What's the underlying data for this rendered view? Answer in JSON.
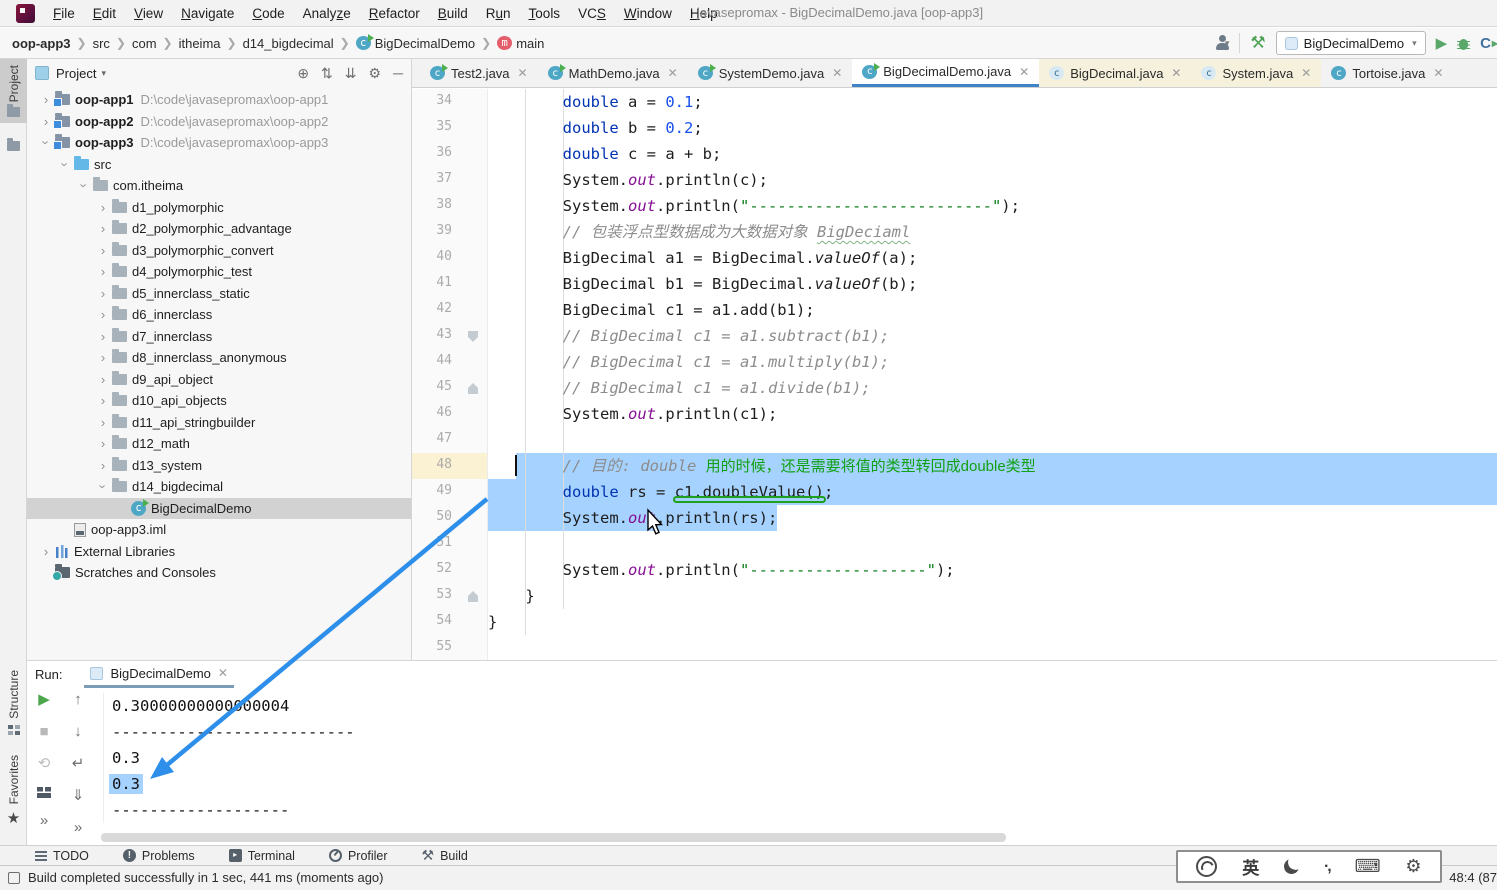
{
  "window": {
    "title": "javasepromax - BigDecimalDemo.java [oop-app3]",
    "menu": [
      {
        "label": "File",
        "u": 0
      },
      {
        "label": "Edit",
        "u": 0
      },
      {
        "label": "View",
        "u": 0
      },
      {
        "label": "Navigate",
        "u": 0
      },
      {
        "label": "Code",
        "u": 0
      },
      {
        "label": "Analyze",
        "u": 5
      },
      {
        "label": "Refactor",
        "u": 0
      },
      {
        "label": "Build",
        "u": 0
      },
      {
        "label": "Run",
        "u": 1
      },
      {
        "label": "Tools",
        "u": 0
      },
      {
        "label": "VCS",
        "u": 2
      },
      {
        "label": "Window",
        "u": 0
      },
      {
        "label": "Help",
        "u": 0
      }
    ]
  },
  "breadcrumb": [
    {
      "label": "oop-app3",
      "icon": null,
      "bold": true
    },
    {
      "label": "src",
      "icon": null
    },
    {
      "label": "com",
      "icon": null
    },
    {
      "label": "itheima",
      "icon": null
    },
    {
      "label": "d14_bigdecimal",
      "icon": null
    },
    {
      "label": "BigDecimalDemo",
      "icon": "class"
    },
    {
      "label": "main",
      "icon": "method"
    }
  ],
  "nav_toolbar": {
    "run_config": "BigDecimalDemo"
  },
  "left_strip": {
    "top_tab": "Project",
    "bottom_tabs": [
      "Structure",
      "Favorites"
    ]
  },
  "project_panel": {
    "title": "Project",
    "actions": [
      "locate",
      "expand-all",
      "collapse-all",
      "settings",
      "hide"
    ],
    "tree": [
      {
        "label": "oop-app1",
        "path": "D:\\code\\javasepromax\\oop-app1",
        "lvl": 0,
        "chev": "closed",
        "icon": "module",
        "bold": true
      },
      {
        "label": "oop-app2",
        "path": "D:\\code\\javasepromax\\oop-app2",
        "lvl": 0,
        "chev": "closed",
        "icon": "module",
        "bold": true
      },
      {
        "label": "oop-app3",
        "path": "D:\\code\\javasepromax\\oop-app3",
        "lvl": 0,
        "chev": "open",
        "icon": "module",
        "bold": true
      },
      {
        "label": "src",
        "lvl": 1,
        "chev": "open",
        "icon": "src"
      },
      {
        "label": "com.itheima",
        "lvl": 2,
        "chev": "open",
        "icon": "package"
      },
      {
        "label": "d1_polymorphic",
        "lvl": 3,
        "chev": "closed",
        "icon": "package"
      },
      {
        "label": "d2_polymorphic_advantage",
        "lvl": 3,
        "chev": "closed",
        "icon": "package"
      },
      {
        "label": "d3_polymorphic_convert",
        "lvl": 3,
        "chev": "closed",
        "icon": "package"
      },
      {
        "label": "d4_polymorphic_test",
        "lvl": 3,
        "chev": "closed",
        "icon": "package"
      },
      {
        "label": "d5_innerclass_static",
        "lvl": 3,
        "chev": "closed",
        "icon": "package"
      },
      {
        "label": "d6_innerclass",
        "lvl": 3,
        "chev": "closed",
        "icon": "package"
      },
      {
        "label": "d7_innerclass",
        "lvl": 3,
        "chev": "closed",
        "icon": "package"
      },
      {
        "label": "d8_innerclass_anonymous",
        "lvl": 3,
        "chev": "closed",
        "icon": "package"
      },
      {
        "label": "d9_api_object",
        "lvl": 3,
        "chev": "closed",
        "icon": "package"
      },
      {
        "label": "d10_api_objects",
        "lvl": 3,
        "chev": "closed",
        "icon": "package"
      },
      {
        "label": "d11_api_stringbuilder",
        "lvl": 3,
        "chev": "closed",
        "icon": "package"
      },
      {
        "label": "d12_math",
        "lvl": 3,
        "chev": "closed",
        "icon": "package"
      },
      {
        "label": "d13_system",
        "lvl": 3,
        "chev": "closed",
        "icon": "package"
      },
      {
        "label": "d14_bigdecimal",
        "lvl": 3,
        "chev": "open",
        "icon": "package"
      },
      {
        "label": "BigDecimalDemo",
        "lvl": 4,
        "chev": null,
        "icon": "class",
        "selected": true
      },
      {
        "label": "oop-app3.iml",
        "lvl": 1,
        "chev": null,
        "icon": "iml"
      },
      {
        "label": "External Libraries",
        "lvl": 0,
        "chev": "closed",
        "icon": "lib"
      },
      {
        "label": "Scratches and Consoles",
        "lvl": 0,
        "chev": null,
        "icon": "scratch"
      }
    ]
  },
  "editor": {
    "tabs": [
      {
        "label": "Test2.java",
        "type": "runnable",
        "active": false
      },
      {
        "label": "MathDemo.java",
        "type": "runnable",
        "active": false
      },
      {
        "label": "SystemDemo.java",
        "type": "runnable",
        "active": false
      },
      {
        "label": "BigDecimalDemo.java",
        "type": "runnable",
        "active": true
      },
      {
        "label": "BigDecimal.java",
        "type": "lib",
        "active": false
      },
      {
        "label": "System.java",
        "type": "lib",
        "active": false
      },
      {
        "label": "Tortoise.java",
        "type": "plain",
        "active": false
      }
    ],
    "first_line": 34,
    "lines": [
      {
        "no": 34,
        "ind": 8,
        "segs": [
          [
            "k",
            "double"
          ],
          [
            "p",
            " a = "
          ],
          [
            "n",
            "0.1"
          ],
          [
            "p",
            ";"
          ]
        ]
      },
      {
        "no": 35,
        "ind": 8,
        "segs": [
          [
            "k",
            "double"
          ],
          [
            "p",
            " b = "
          ],
          [
            "n",
            "0.2"
          ],
          [
            "p",
            ";"
          ]
        ]
      },
      {
        "no": 36,
        "ind": 8,
        "segs": [
          [
            "k",
            "double"
          ],
          [
            "p",
            " c = a + b;"
          ]
        ]
      },
      {
        "no": 37,
        "ind": 8,
        "segs": [
          [
            "p",
            "System."
          ],
          [
            "f",
            "out"
          ],
          [
            "p",
            ".println(c);"
          ]
        ]
      },
      {
        "no": 38,
        "ind": 8,
        "segs": [
          [
            "p",
            "System."
          ],
          [
            "f",
            "out"
          ],
          [
            "p",
            ".println("
          ],
          [
            "s",
            "\"--------------------------\""
          ],
          [
            "p",
            ");"
          ]
        ]
      },
      {
        "no": 39,
        "ind": 8,
        "segs": [
          [
            "c",
            "// 包装浮点型数据成为大数据对象 "
          ],
          [
            "cw",
            "BigDeciaml"
          ]
        ]
      },
      {
        "no": 40,
        "ind": 8,
        "segs": [
          [
            "p",
            "BigDecimal a1 = BigDecimal."
          ],
          [
            "m",
            "valueOf"
          ],
          [
            "p",
            "(a);"
          ]
        ]
      },
      {
        "no": 41,
        "ind": 8,
        "segs": [
          [
            "p",
            "BigDecimal b1 = BigDecimal."
          ],
          [
            "m",
            "valueOf"
          ],
          [
            "p",
            "(b);"
          ]
        ]
      },
      {
        "no": 42,
        "ind": 8,
        "segs": [
          [
            "p",
            "BigDecimal c1 = a1.add(b1);"
          ]
        ]
      },
      {
        "no": 43,
        "ind": 8,
        "fold": "down",
        "segs": [
          [
            "c",
            "// BigDecimal c1 = a1.subtract(b1);"
          ]
        ]
      },
      {
        "no": 44,
        "ind": 8,
        "segs": [
          [
            "c",
            "// BigDecimal c1 = a1.multiply(b1);"
          ]
        ]
      },
      {
        "no": 45,
        "ind": 8,
        "fold": "up",
        "segs": [
          [
            "c",
            "// BigDecimal c1 = a1.divide(b1);"
          ]
        ]
      },
      {
        "no": 46,
        "ind": 8,
        "segs": [
          [
            "p",
            "System."
          ],
          [
            "f",
            "out"
          ],
          [
            "p",
            ".println(c1);"
          ]
        ]
      },
      {
        "no": 47,
        "ind": 0,
        "segs": []
      },
      {
        "no": 48,
        "ind": 8,
        "gutterHl": true,
        "caret": 3,
        "selStart": 3,
        "selEnd": "full",
        "segs": [
          [
            "c",
            "// 目的: double "
          ],
          [
            "g",
            "用的时候，还是需要将值的类型转回成double类型"
          ]
        ]
      },
      {
        "no": 49,
        "ind": 8,
        "selStart": 0,
        "selEnd": "full",
        "segs": [
          [
            "k",
            "double"
          ],
          [
            "p",
            " rs = "
          ],
          [
            "gu",
            "c1.doubleValue()"
          ],
          [
            "p",
            ";"
          ]
        ]
      },
      {
        "no": 50,
        "ind": 8,
        "selStart": 0,
        "selEnd": 31,
        "segs": [
          [
            "p",
            "System."
          ],
          [
            "f",
            "out"
          ],
          [
            "p",
            ".println(rs);"
          ]
        ]
      },
      {
        "no": 51,
        "ind": 0,
        "segs": []
      },
      {
        "no": 52,
        "ind": 8,
        "segs": [
          [
            "p",
            "System."
          ],
          [
            "f",
            "out"
          ],
          [
            "p",
            ".println("
          ],
          [
            "s",
            "\"-------------------\""
          ],
          [
            "p",
            ");"
          ]
        ]
      },
      {
        "no": 53,
        "ind": 4,
        "fold": "up",
        "segs": [
          [
            "p",
            "}"
          ]
        ]
      },
      {
        "no": 54,
        "ind": 0,
        "segs": [
          [
            "p",
            "}"
          ]
        ]
      },
      {
        "no": 55,
        "ind": 0,
        "segs": []
      }
    ]
  },
  "run_panel": {
    "label": "Run:",
    "tab": "BigDecimalDemo",
    "toolbar_left": [
      "rerun",
      "stop",
      "restart-debug",
      "layout",
      "more"
    ],
    "toolbar_right": [
      "up",
      "down",
      "soft-wrap",
      "scroll-end",
      "more"
    ],
    "console": [
      {
        "text": "0.30000000000000004",
        "hl": false
      },
      {
        "text": "--------------------------",
        "hl": false
      },
      {
        "text": "0.3",
        "hl": false
      },
      {
        "text": "0.3",
        "hl": true
      },
      {
        "text": "-------------------",
        "hl": false
      }
    ]
  },
  "tool_buttons": [
    {
      "icon": "todo",
      "label": "TODO"
    },
    {
      "icon": "problems",
      "label": "Problems"
    },
    {
      "icon": "terminal",
      "label": "Terminal"
    },
    {
      "icon": "profiler",
      "label": "Profiler"
    },
    {
      "icon": "build",
      "label": "Build"
    }
  ],
  "status_bar": {
    "message": "Build completed successfully in 1 sec, 441 ms (moments ago)",
    "position": "48:4 (87"
  },
  "ime": {
    "lang": "英"
  },
  "colors": {
    "selection": "#A6D2FF",
    "tab_accent": "#4083C9",
    "annotation_green": "#12A014",
    "annotation_arrow": "#2E8FEA",
    "keyword": "#0033B3",
    "number": "#1750EB",
    "string": "#067D17",
    "comment": "#8C8C8C",
    "field": "#871094"
  }
}
